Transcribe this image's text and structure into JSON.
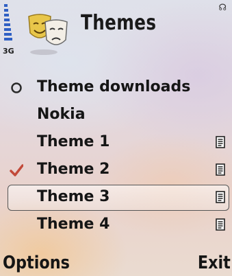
{
  "header": {
    "title": "Themes",
    "network": "3G",
    "icon": "theatre-masks-icon"
  },
  "list": {
    "items": [
      {
        "label": "Theme downloads",
        "mark": "globe-icon",
        "doc": false,
        "selected": false
      },
      {
        "label": "Nokia",
        "mark": "",
        "doc": false,
        "selected": false
      },
      {
        "label": "Theme 1",
        "mark": "",
        "doc": true,
        "selected": false
      },
      {
        "label": "Theme 2",
        "mark": "checkmark-icon",
        "doc": true,
        "selected": false
      },
      {
        "label": "Theme 3",
        "mark": "",
        "doc": true,
        "selected": true
      },
      {
        "label": "Theme 4",
        "mark": "",
        "doc": true,
        "selected": false
      }
    ]
  },
  "softkeys": {
    "left": "Options",
    "right": "Exit"
  },
  "colors": {
    "signal": "#2f5fc4",
    "check": "#c24a3a",
    "text": "#151515"
  }
}
